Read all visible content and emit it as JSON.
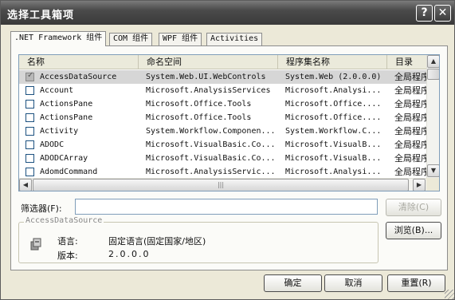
{
  "window": {
    "title": "选择工具箱项",
    "help_label": "?",
    "close_label": "✕"
  },
  "tabs": [
    {
      "label": ".NET Framework 组件",
      "active": true
    },
    {
      "label": "COM 组件",
      "active": false
    },
    {
      "label": "WPF 组件",
      "active": false
    },
    {
      "label": "Activities",
      "active": false
    }
  ],
  "list": {
    "columns": [
      "名称",
      "命名空间",
      "程序集名称",
      "目录"
    ],
    "rows": [
      {
        "checked": true,
        "selected": true,
        "name": "AccessDataSource",
        "namespace": "System.Web.UI.WebControls",
        "assembly": "System.Web (2.0.0.0)",
        "directory": "全局程序"
      },
      {
        "checked": false,
        "selected": false,
        "name": "Account",
        "namespace": "Microsoft.AnalysisServices",
        "assembly": "Microsoft.Analysi...",
        "directory": "全局程序"
      },
      {
        "checked": false,
        "selected": false,
        "name": "ActionsPane",
        "namespace": "Microsoft.Office.Tools",
        "assembly": "Microsoft.Office....",
        "directory": "全局程序"
      },
      {
        "checked": false,
        "selected": false,
        "name": "ActionsPane",
        "namespace": "Microsoft.Office.Tools",
        "assembly": "Microsoft.Office....",
        "directory": "全局程序"
      },
      {
        "checked": false,
        "selected": false,
        "name": "Activity",
        "namespace": "System.Workflow.Componen...",
        "assembly": "System.Workflow.C...",
        "directory": "全局程序"
      },
      {
        "checked": false,
        "selected": false,
        "name": "ADODC",
        "namespace": "Microsoft.VisualBasic.Co...",
        "assembly": "Microsoft.VisualB...",
        "directory": "全局程序"
      },
      {
        "checked": false,
        "selected": false,
        "name": "ADODCArray",
        "namespace": "Microsoft.VisualBasic.Co...",
        "assembly": "Microsoft.VisualB...",
        "directory": "全局程序"
      },
      {
        "checked": false,
        "selected": false,
        "name": "AdomdCommand",
        "namespace": "Microsoft.AnalysisServic...",
        "assembly": "Microsoft.Analysi...",
        "directory": "全局程序"
      }
    ],
    "scroll_up": "▲",
    "scroll_down": "▼",
    "scroll_left": "◀",
    "scroll_right": "▶",
    "grip": "|||"
  },
  "filter": {
    "label": "筛选器(F):",
    "value": "",
    "clear_label": "清除(C)"
  },
  "details": {
    "group_title": "AccessDataSource",
    "language_label": "语言:",
    "language_value": "固定语言(固定国家/地区)",
    "version_label": "版本:",
    "version_value": "2.0.0.0",
    "icon": "assembly-icon"
  },
  "buttons": {
    "browse": "浏览(B)...",
    "ok": "确定",
    "cancel": "取消",
    "reset": "重置(R)"
  }
}
